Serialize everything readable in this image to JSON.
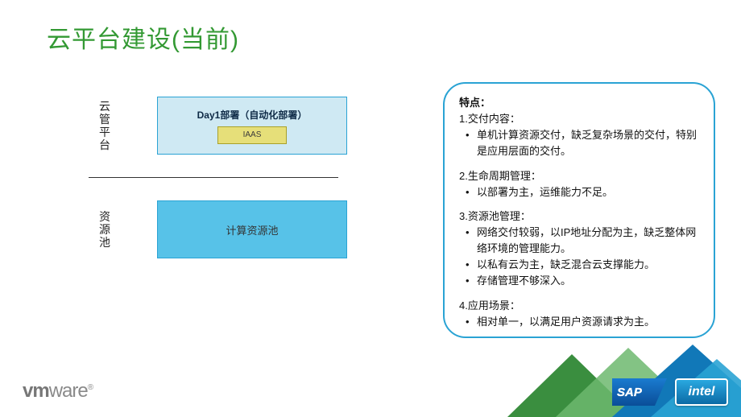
{
  "title": "云平台建设(当前)",
  "diagram": {
    "section1_label": "云管平台",
    "day1_box_title": "Day1部署（自动化部署）",
    "iaas_label": "IAAS",
    "section2_label": "资源池",
    "pool_box_label": "计算资源池"
  },
  "panel": {
    "heading": "特点：",
    "sec1_title": "1.交付内容：",
    "sec1_b1": "单机计算资源交付，缺乏复杂场景的交付，特别是应用层面的交付。",
    "sec2_title": "2.生命周期管理：",
    "sec2_b1": "以部署为主，运维能力不足。",
    "sec3_title": "3.资源池管理：",
    "sec3_b1": "网络交付较弱，以IP地址分配为主，缺乏整体网络环境的管理能力。",
    "sec3_b2": "以私有云为主，缺乏混合云支撑能力。",
    "sec3_b3": "存储管理不够深入。",
    "sec4_title": "4.应用场景：",
    "sec4_b1": "相对单一，以满足用户资源请求为主。"
  },
  "logos": {
    "vmware_bold": "vm",
    "vmware_rest": "ware",
    "sap": "SAP",
    "intel": "intel"
  }
}
